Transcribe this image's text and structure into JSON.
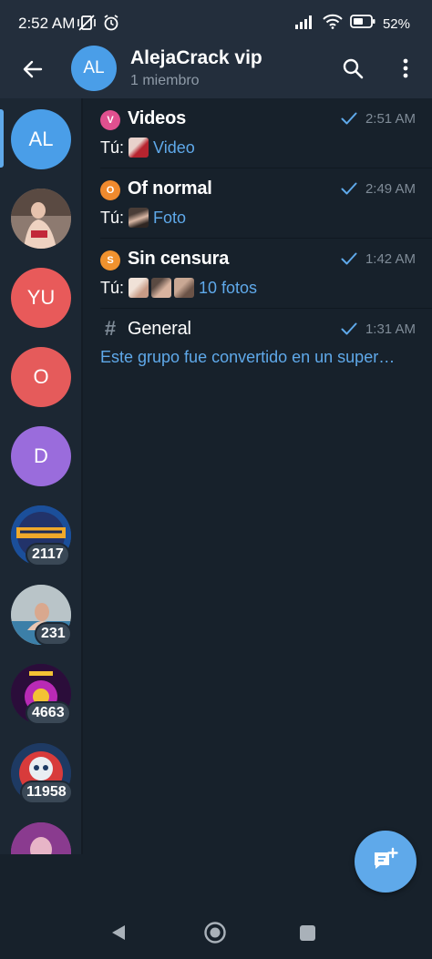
{
  "status_bar": {
    "time": "2:52 AM",
    "battery": "52%",
    "icons": [
      "mute-vibrate-icon",
      "alarm-icon",
      "signal-icon",
      "wifi-icon",
      "battery-icon"
    ]
  },
  "header": {
    "avatar_initials": "AL",
    "title": "AlejaCrack vip",
    "subtitle": "1 miembro"
  },
  "sidebar": {
    "items": [
      {
        "initials": "AL",
        "color": "#4a9ee8",
        "active": true
      },
      {
        "initials": "",
        "color": "#6b5a52",
        "kind": "photo"
      },
      {
        "initials": "YU",
        "color": "#e85a5a"
      },
      {
        "initials": "O",
        "color": "#e55b5b"
      },
      {
        "initials": "D",
        "color": "#9a6cdc"
      },
      {
        "initials": "",
        "color": "#1b4f9a",
        "kind": "photo",
        "badge": "2117"
      },
      {
        "initials": "",
        "color": "#6d7f86",
        "kind": "photo",
        "badge": "231"
      },
      {
        "initials": "",
        "color": "#3a1450",
        "kind": "photo",
        "badge": "4663"
      },
      {
        "initials": "",
        "color": "#1e3a63",
        "kind": "photo",
        "badge": "11958"
      },
      {
        "initials": "",
        "color": "#8a3b8f",
        "kind": "photo"
      }
    ]
  },
  "topics": [
    {
      "icon": "V",
      "icon_color": "#e0508f",
      "title": "Videos",
      "time": "2:51 AM",
      "sender": "Tú:",
      "media": "Video",
      "read": true
    },
    {
      "icon": "O",
      "icon_color": "#f08a2e",
      "title": "Of normal",
      "time": "2:49 AM",
      "sender": "Tú:",
      "media": "Foto",
      "read": true
    },
    {
      "icon": "S",
      "icon_color": "#f0922e",
      "title": "Sin censura",
      "time": "1:42 AM",
      "sender": "Tú:",
      "media": "10 fotos",
      "read": true
    },
    {
      "icon": "#",
      "icon_color": "#7f8b97",
      "title": "General",
      "time": "1:31 AM",
      "preview": "Este grupo fue convertido en un super…",
      "read": true
    }
  ],
  "fab": {
    "icon": "new-topic-icon"
  },
  "nav_bar": {
    "icons": [
      "nav-back-icon",
      "nav-home-icon",
      "nav-recents-icon"
    ]
  }
}
